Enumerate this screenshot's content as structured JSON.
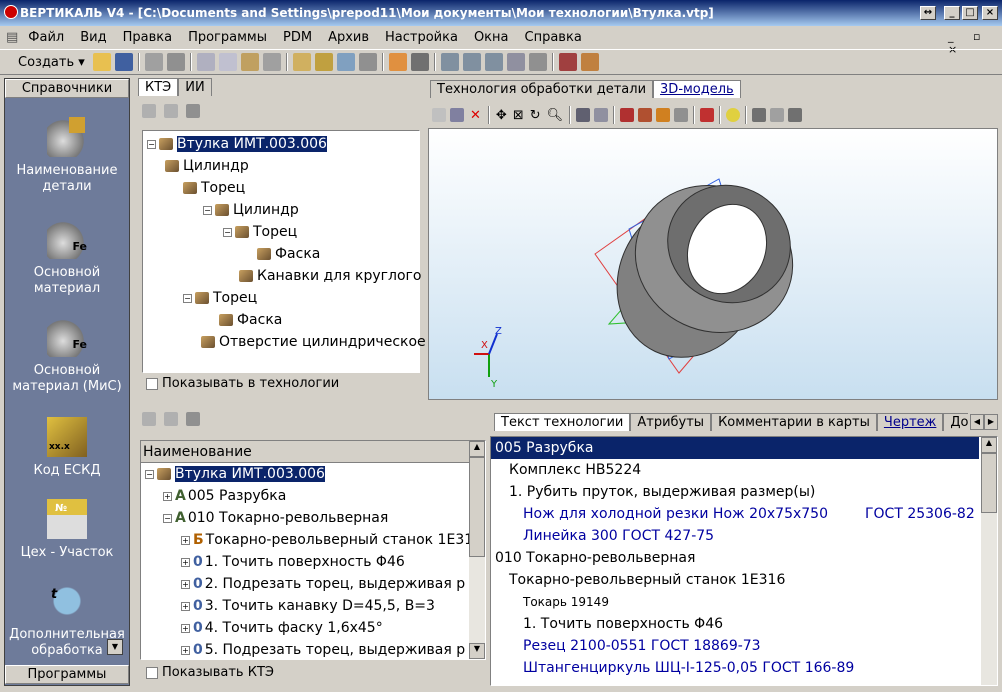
{
  "window": {
    "title": "ВЕРТИКАЛЬ V4 - [C:\\Documents and Settings\\prepod11\\Мои документы\\Мои технологии\\Втулка.vtp]"
  },
  "menu": [
    "Файл",
    "Вид",
    "Правка",
    "Программы",
    "PDM",
    "Архив",
    "Настройка",
    "Окна",
    "Справка"
  ],
  "toolbar": {
    "create_label": "Создать"
  },
  "left": {
    "header": "Справочники",
    "footer": "Программы",
    "items": [
      "Наименование детали",
      "Основной материал",
      "Основной материал (МиС)",
      "Код ЕСКД",
      "Цех - Участок",
      "Дополнительная обработка"
    ]
  },
  "kte": {
    "tabs": [
      "КТЭ",
      "ИИ"
    ],
    "tree": [
      "Втулка ИМТ.003.006",
      "Цилиндр",
      "Торец",
      "Цилиндр",
      "Торец",
      "Фаска",
      "Канавки для круглого",
      "Торец",
      "Фаска",
      "Отверстие цилиндрическое"
    ],
    "show_label": "Показывать в технологии"
  },
  "view": {
    "tabs": [
      "Технология обработки детали",
      "3D-модель"
    ],
    "axes": [
      "Z",
      "X",
      "Y"
    ]
  },
  "proc": {
    "header": "Наименование",
    "tree": [
      "Втулка ИМТ.003.006",
      "005 Разрубка",
      "010 Токарно-револьверная",
      "Токарно-револьверный станок 1Е31",
      "1. Точить поверхность Φ46",
      "2. Подрезать торец, выдерживая р",
      "3. Точить канавку D=45,5, B=3",
      "4. Точить фаску 1,6x45°",
      "5. Подрезать торец, выдерживая р"
    ],
    "show_label": "Показывать КТЭ"
  },
  "text": {
    "tabs": [
      "Текст технологии",
      "Атрибуты",
      "Комментарии в карты",
      "Чертеж",
      "Докуме"
    ],
    "lines": [
      "005 Разрубка",
      "Комплекс НВ5224",
      "1. Рубить пруток, выдерживая размер(ы)",
      "Нож для холодной резки Нож 20x75x750",
      "ГОСТ 25306-82",
      "Линейка 300 ГОСТ 427-75",
      "010 Токарно-револьверная",
      "Токарно-револьверный станок 1Е316",
      "Токарь 19149",
      "1. Точить поверхность Φ46",
      "Резец 2100-0551 ГОСТ 18869-73",
      "Штангенциркуль ШЦ-I-125-0,05 ГОСТ 166-89"
    ]
  }
}
